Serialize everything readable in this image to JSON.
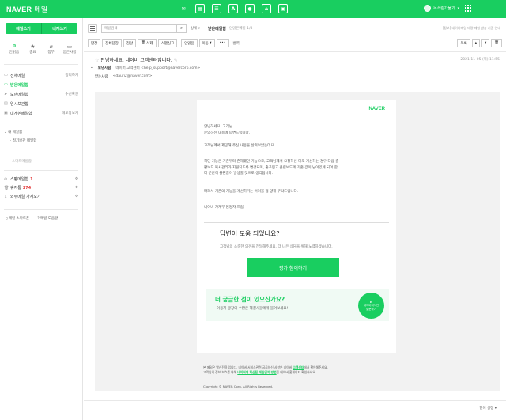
{
  "topbar": {
    "logo": "NAVER",
    "logo_sub": "메일",
    "user": "목소린가물기",
    "apps": [
      {
        "icon": "mail-icon",
        "glyph": "✉"
      },
      {
        "icon": "calendar-icon",
        "glyph": "▦"
      },
      {
        "icon": "contacts-icon",
        "glyph": "☰"
      },
      {
        "icon": "memo-icon",
        "glyph": "A"
      },
      {
        "icon": "mybox-icon",
        "glyph": "●"
      },
      {
        "icon": "home-icon",
        "glyph": "⌂"
      },
      {
        "icon": "works-icon",
        "glyph": "▣"
      }
    ]
  },
  "sidebar": {
    "write_label": "메일쓰기",
    "self_write_label": "내게쓰기",
    "quick": [
      {
        "value": "0",
        "label": "안읽음"
      },
      {
        "icon": "star-icon",
        "glyph": "★",
        "label": "중요"
      },
      {
        "icon": "clip-icon",
        "glyph": "⌀",
        "label": "첨부"
      },
      {
        "icon": "vip-icon",
        "glyph": "▭",
        "label": "받은사람"
      }
    ],
    "folders": [
      {
        "label": "전체메일",
        "extra": "정리하기"
      },
      {
        "label": "받은메일함",
        "extra": ""
      },
      {
        "label": "보낸메일함",
        "extra": "수신확인"
      },
      {
        "label": "임시보관함",
        "extra": ""
      },
      {
        "label": "내게쓴메일함",
        "extra": "메모장보기"
      }
    ],
    "my_folders_title": "내 메일함",
    "my_folder_item": "정기보관 메일함",
    "empty_folder": "스마트메일함",
    "misc": [
      {
        "label": "스팸메일함",
        "badge": "1"
      },
      {
        "label": "휴지통",
        "badge": "274"
      },
      {
        "label": "외부메일 가져오기",
        "badge": ""
      }
    ],
    "bottom_links": [
      "메일 스마트폰",
      "메일 도움말"
    ]
  },
  "toolbar": {
    "search_placeholder": "메일검색",
    "detail_label": "상세",
    "mailbox_name": "받은메일함",
    "mailbox_count": "안읽은메일 1/8",
    "right_text": "[정보] 네이버메일 대량 메일 발송 기준 안내",
    "buttons": [
      "답장",
      "전체답장",
      "전달",
      "삭제",
      "스팸신고",
      "안읽음",
      "이동",
      "•••",
      "번역"
    ],
    "right_buttons": [
      "목록",
      "▴",
      "▾",
      "🗑"
    ]
  },
  "mail": {
    "subject": "안녕하세요. 네이버 고객센터입니다.",
    "date": "2021-11-05 (목) 11:55",
    "from_label": "보낸사람",
    "from_value": "네이버 고객센터 <help_support@navercorp.com>",
    "to_label": "받는사람",
    "to_value": "<dauri2@naver.com>"
  },
  "body": {
    "brand": "NAVER",
    "greeting": [
      "안녕하세요. 고객님.",
      "문의하신 내용에 답변드립니다."
    ],
    "line1": "고객님께서 제공해 주신 내용을 살펴보았는데요.",
    "para1": [
      "해당 기능은 기존부터 존재했던 기능으로, 고객님께서 요청하신 대로 개선하는 경우 다음 출",
      "판보드 복사관리가 지원되도록 변경되며, 출구민고 클립보드에 기존 값이 남아있게 되어 한",
      "데 곤란이 불편함이 발생할 것으로 생각됩니다."
    ],
    "line2": "따라서 기존의 기능을 개선하기는 어려울 점 양해 부탁드립니다.",
    "sign": "네이버 가계부 담당자 드림",
    "question_title": "답변이 도움 되었나요?",
    "question_desc": "고객님의 소중한 의견을 전달해주세요. 더 나은 상담을 위해 노력하겠습니다.",
    "rate_button": "평가 참여하기",
    "more_title": "더 궁금한 점이 있으신가요?",
    "more_desc": "이용자 궁장의 수많은 해결사들에게 물어보세요!",
    "circle_top": "N",
    "circle_line1": "네이버지식인",
    "circle_line2": "질문하기",
    "footer1": "본 메일은 발신전용 입니다. 네이버 서비스관련 궁금하신 사항은 네이버 ",
    "footer1_link": "고객센터",
    "footer1_end": "에서 확인해주세요.",
    "footer2": "고객님의 정보 보호를 위해 ",
    "footer2_link": "네이버에 회신된 메일인지 방법",
    "footer2_end": "을 네이버 홈페이지 확인하세요.",
    "copyright": "Copyright © NAVER Corp. All Rights Reserved."
  },
  "bottom": {
    "language": "언어 설정 ▾"
  }
}
